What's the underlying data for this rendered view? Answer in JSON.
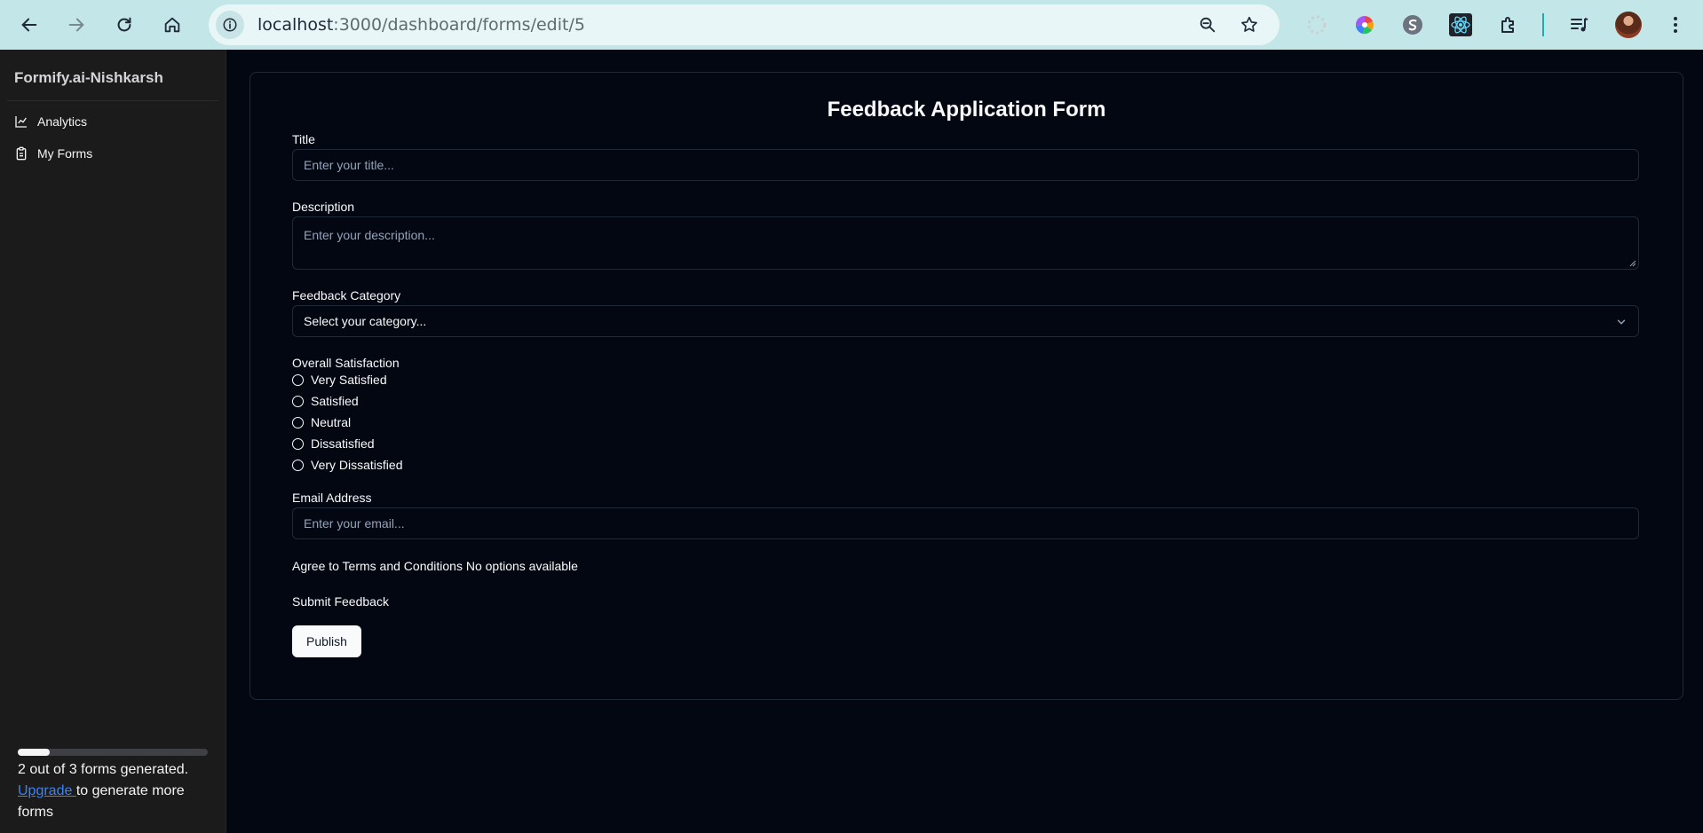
{
  "browser": {
    "url_host": "localhost",
    "url_rest": ":3000/dashboard/forms/edit/5"
  },
  "sidebar": {
    "brand": "Formify.ai-Nishkarsh",
    "items": [
      {
        "label": "Analytics",
        "icon": "line-chart-icon"
      },
      {
        "label": "My Forms",
        "icon": "clipboard-icon"
      }
    ],
    "usage": {
      "progress_fraction": 0.1667,
      "text": "2 out of 3 forms generated.",
      "upgrade_link": "Upgrade ",
      "upgrade_suffix": "to generate more forms"
    }
  },
  "form": {
    "title": "Feedback Application Form",
    "fields": {
      "title_label": "Title",
      "title_placeholder": "Enter your title...",
      "description_label": "Description",
      "description_placeholder": "Enter your description...",
      "category_label": "Feedback Category",
      "category_value": "Select your category...",
      "satisfaction_label": "Overall Satisfaction",
      "satisfaction_options": [
        "Very Satisfied",
        "Satisfied",
        "Neutral",
        "Dissatisfied",
        "Very Dissatisfied"
      ],
      "email_label": "Email Address",
      "email_placeholder": "Enter your email...",
      "terms_text": "Agree to Terms and Conditions No options available",
      "submit_text": "Submit Feedback"
    },
    "publish_label": "Publish"
  },
  "colors": {
    "chrome_bg": "#c3e6e8",
    "sidebar_bg": "#1b1b1b",
    "main_bg": "#030712",
    "link": "#3b82f6"
  }
}
